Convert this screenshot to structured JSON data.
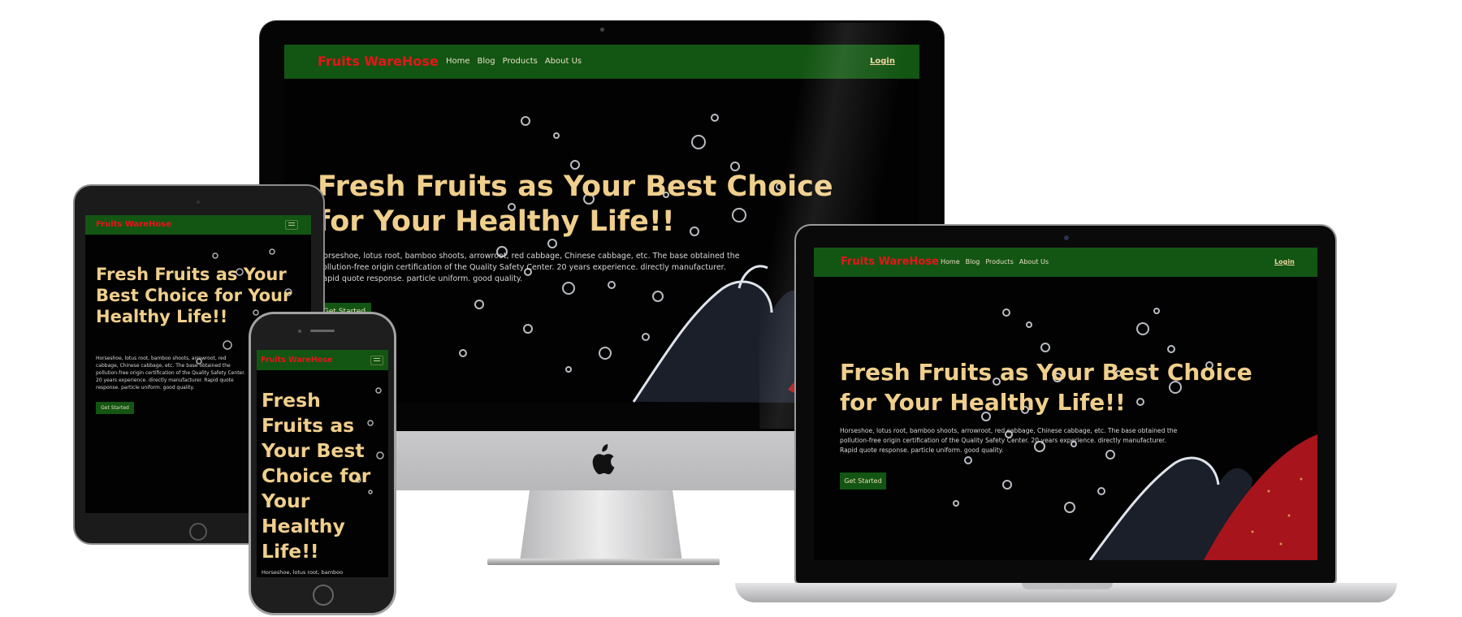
{
  "site": {
    "brand": "Fruits WareHose",
    "nav": [
      "Home",
      "Blog",
      "Products",
      "About Us"
    ],
    "login": "Login",
    "hero_title_line1": "Fresh Fruits as Your Best Choice",
    "hero_title_line2": "for Your Healthy Life!!",
    "hero_text": "Horseshoe, lotus root, bamboo shoots, arrowroot, red cabbage, Chinese cabbage, etc. The base obtained the pollution-free origin certification of the Quality Safety Center. 20 years experience. directly manufacturer. Rapid quote response. particle uniform. good quality.",
    "cta": "Get Started"
  },
  "iphone": {
    "title": "Fresh Fruits as Your Best Choice for Your Healthy Life!!",
    "text": "Horseshoe, lotus root, bamboo"
  },
  "colors": {
    "navbar": "#135513",
    "brand": "#e8141a",
    "hero_title": "#f0cf8c",
    "background": "#020202"
  },
  "icons": {
    "apple": "apple-logo-icon",
    "menu": "hamburger-menu-icon"
  }
}
